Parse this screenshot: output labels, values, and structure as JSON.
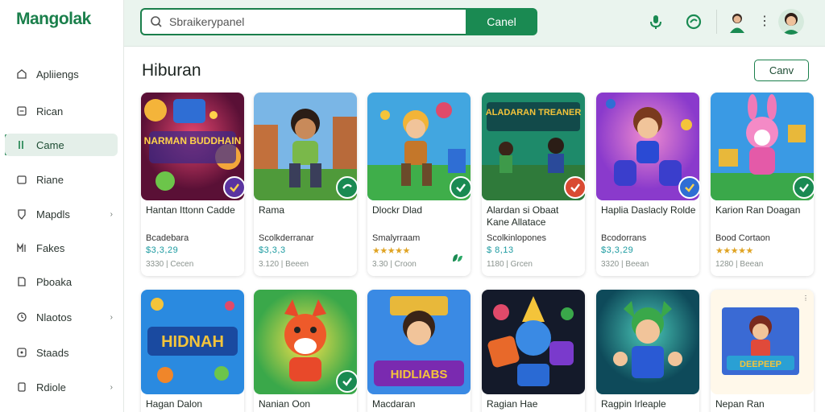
{
  "app": {
    "logo": "Mangolak"
  },
  "sidebar": {
    "items": [
      {
        "label": "Apliiengs",
        "icon": "home-icon"
      },
      {
        "label": "Rican",
        "icon": "list-icon"
      },
      {
        "label": "Came",
        "icon": "game-icon",
        "active": true
      },
      {
        "label": "Riane",
        "icon": "page-icon"
      },
      {
        "label": "Mapdls",
        "icon": "shield-icon",
        "chevron": "›"
      },
      {
        "label": "Fakes",
        "icon": "grid-icon"
      },
      {
        "label": "Pboaka",
        "icon": "book-icon"
      },
      {
        "label": "Nlaotos",
        "icon": "clock-icon",
        "chevron": "›"
      },
      {
        "label": "Staads",
        "icon": "box-icon"
      },
      {
        "label": "Rdiole",
        "icon": "doc-icon",
        "chevron": "›"
      }
    ]
  },
  "header": {
    "search_placeholder": "Sbraikerypanel",
    "search_button": "Canel",
    "icons": [
      "mic-icon",
      "chat-icon",
      "user-icon"
    ],
    "kebab": "⋮"
  },
  "main": {
    "section_title": "Hiburan",
    "top_button": "Canv",
    "cards": [
      {
        "title": "Hantan  Ittonn Cadde",
        "publisher": "Bcadebara",
        "rating": "$3,3,29",
        "meta": "3330 | Cecen",
        "rating_style": "text"
      },
      {
        "title": "Rama",
        "publisher": "Scolkderranar",
        "rating": "$3,3,3",
        "meta": "3.120 | Beeen",
        "rating_style": "text"
      },
      {
        "title": "Dlockr Dlad",
        "publisher": "Smalyrraam",
        "rating": "★★★★★",
        "meta": "3.30 | Croon",
        "rating_style": "stars"
      },
      {
        "title": "Alardan si Obaat Kane Allatace",
        "publisher": "Scolkinlopones",
        "rating": "$ 8,13",
        "meta": "1180 | Grcen",
        "rating_style": "text"
      },
      {
        "title": "Haplia Daslacly Rolde",
        "publisher": "Bcodorrans",
        "rating": "$3,3,29",
        "meta": "3320 | Beean",
        "rating_style": "text"
      },
      {
        "title": "Karion Ran Doagan",
        "publisher": "Bood Cortaon",
        "rating": "★★★★★",
        "meta": "1280 | Beean",
        "rating_style": "stars"
      }
    ],
    "cards_row2": [
      {
        "title": "Hagan Dalon",
        "art_text": "HIDNAH"
      },
      {
        "title": "Nanian Oon",
        "art_text": ""
      },
      {
        "title": "Macdaran",
        "art_text": "HIDLIABS"
      },
      {
        "title": "Ragian Hae",
        "art_text": ""
      },
      {
        "title": "Ragpin Irleaple",
        "art_text": ""
      },
      {
        "title": "Nepan Ran",
        "art_text": "DEEPEEP"
      }
    ],
    "row1_art_text": [
      "NARMAN BUDDHAIN",
      "",
      "",
      "ALADARAN TREANER",
      "",
      ""
    ]
  },
  "colors": {
    "accent": "#1a7f4b",
    "header_bg": "#eaf4ee",
    "active_bg": "#e4efe9"
  }
}
